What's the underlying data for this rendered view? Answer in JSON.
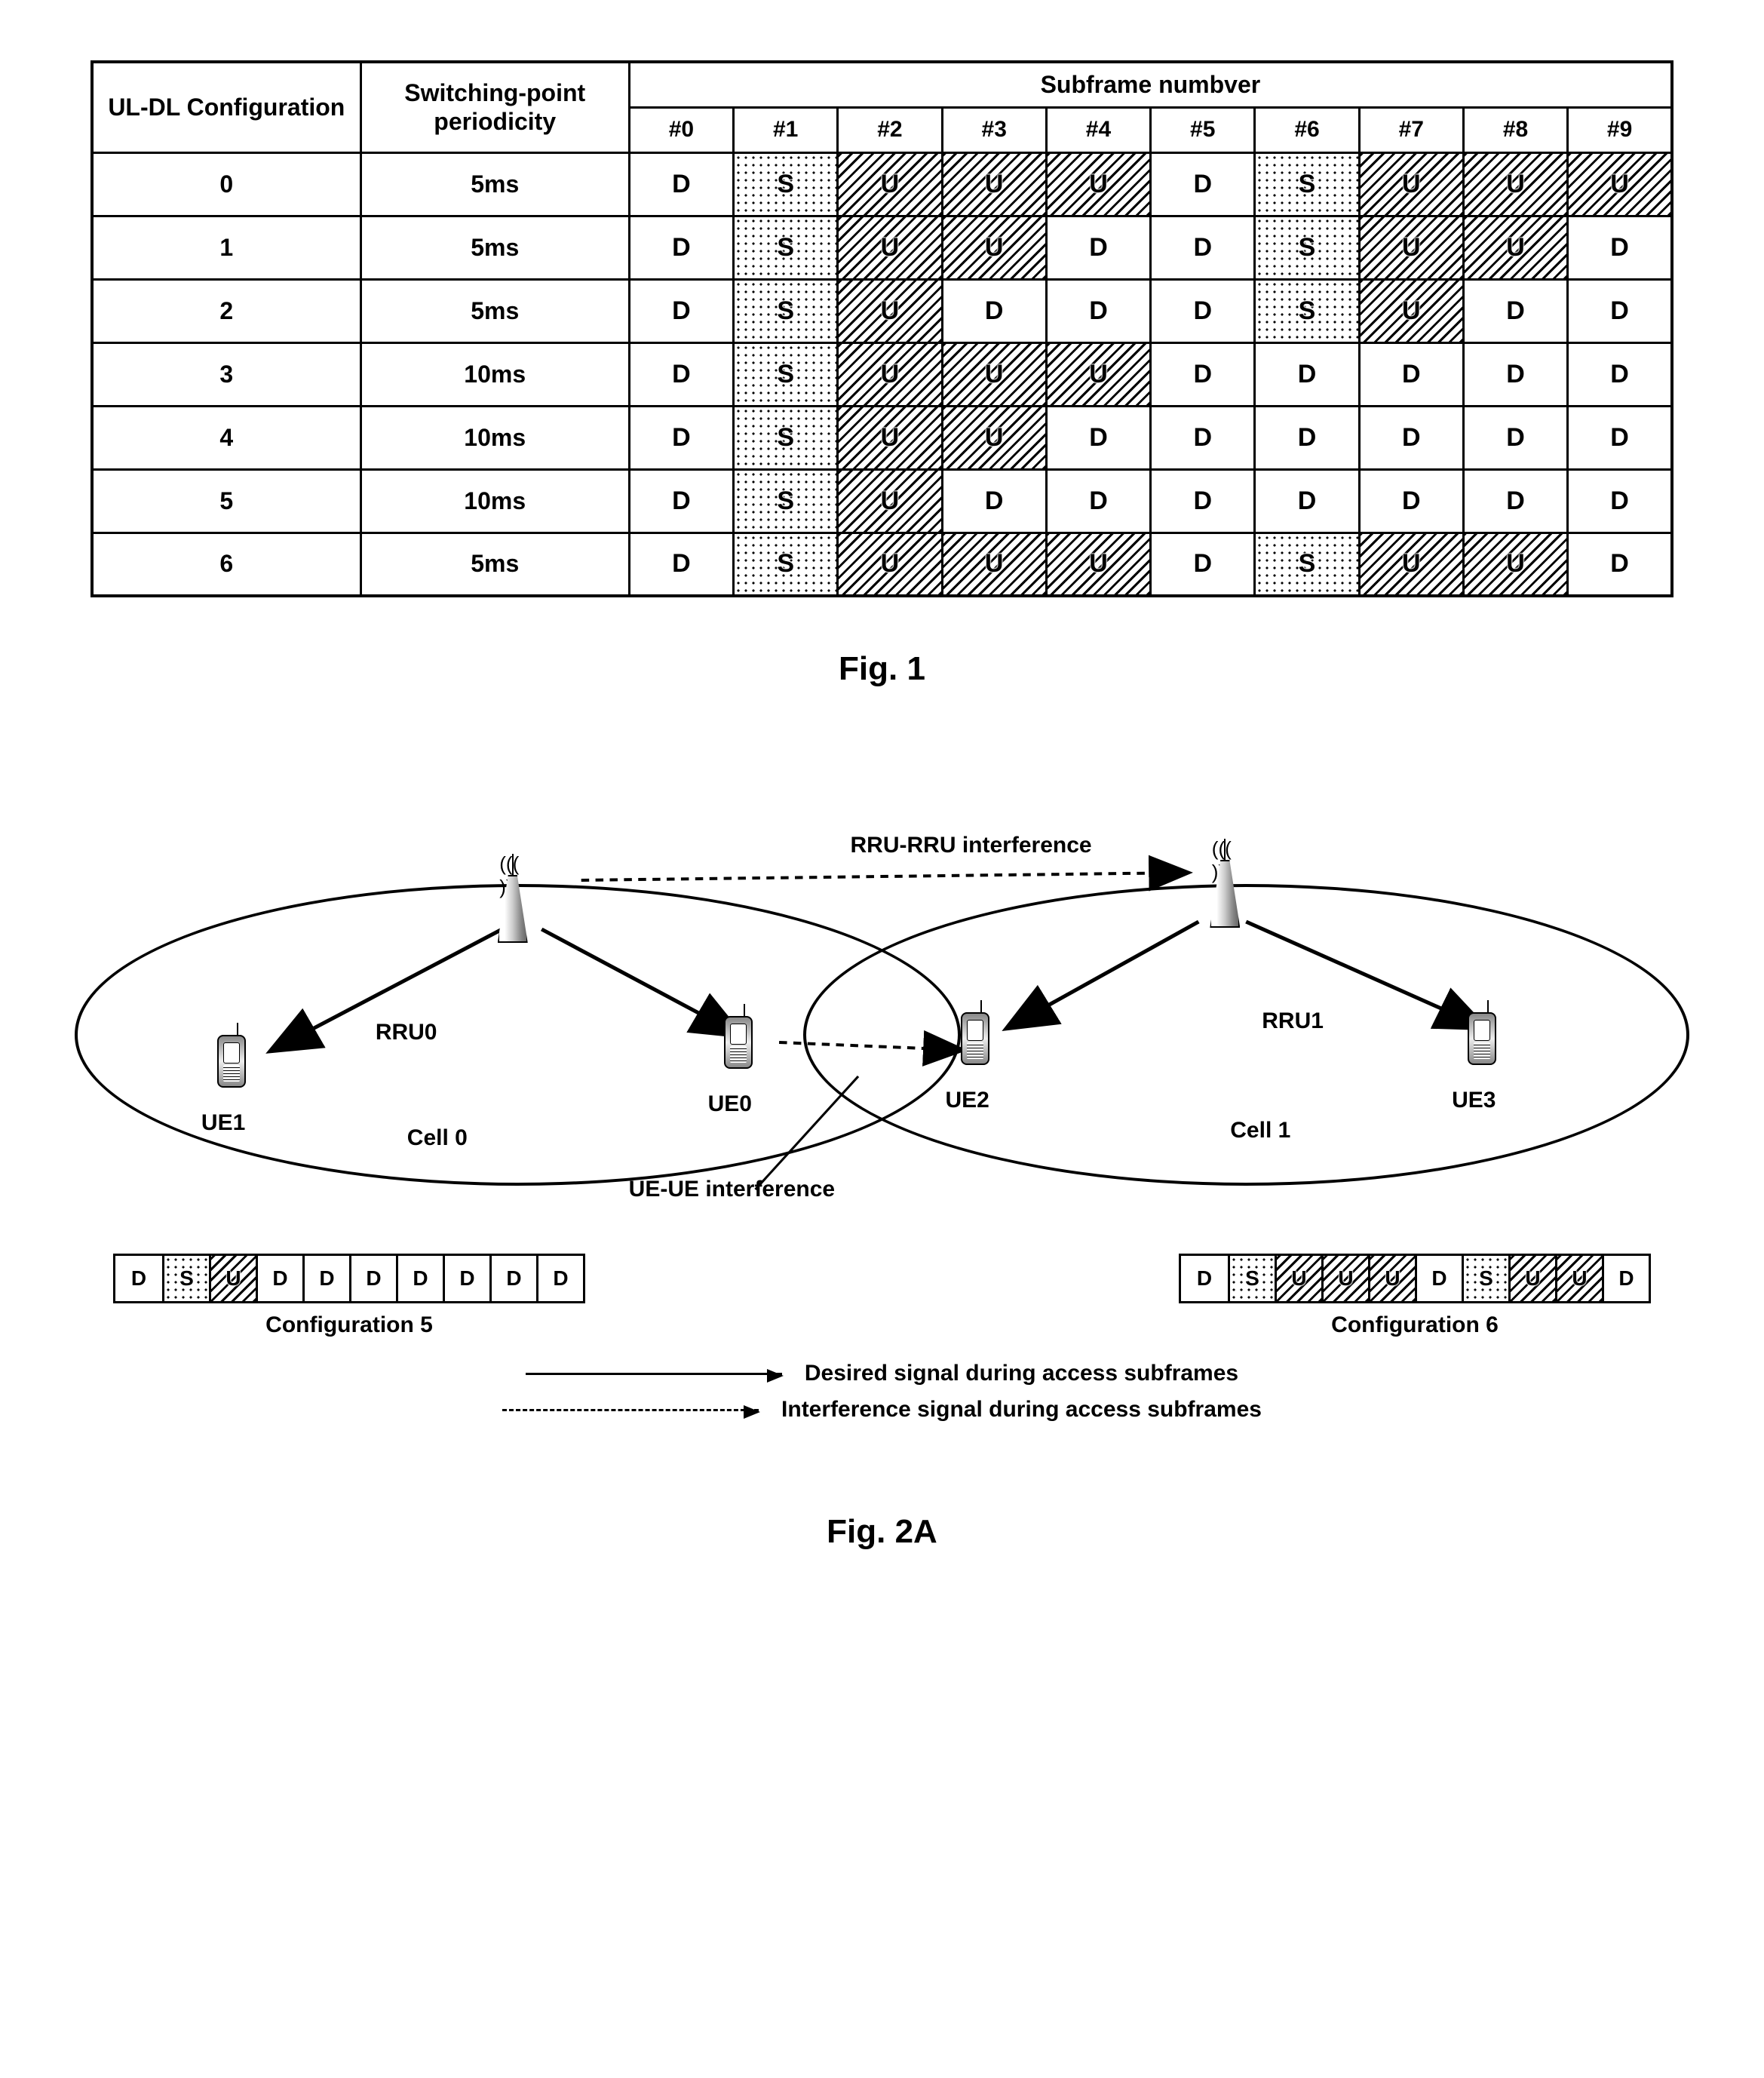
{
  "fig1": {
    "header_col1": "UL-DL Configuration",
    "header_col2": "Switching-point periodicity",
    "header_group": "Subframe numbver",
    "subframe_headers": [
      "#0",
      "#1",
      "#2",
      "#3",
      "#4",
      "#5",
      "#6",
      "#7",
      "#8",
      "#9"
    ],
    "rows": [
      {
        "config": "0",
        "period": "5ms",
        "cells": [
          "D",
          "S",
          "U",
          "U",
          "U",
          "D",
          "S",
          "U",
          "U",
          "U"
        ]
      },
      {
        "config": "1",
        "period": "5ms",
        "cells": [
          "D",
          "S",
          "U",
          "U",
          "D",
          "D",
          "S",
          "U",
          "U",
          "D"
        ]
      },
      {
        "config": "2",
        "period": "5ms",
        "cells": [
          "D",
          "S",
          "U",
          "D",
          "D",
          "D",
          "S",
          "U",
          "D",
          "D"
        ]
      },
      {
        "config": "3",
        "period": "10ms",
        "cells": [
          "D",
          "S",
          "U",
          "U",
          "U",
          "D",
          "D",
          "D",
          "D",
          "D"
        ]
      },
      {
        "config": "4",
        "period": "10ms",
        "cells": [
          "D",
          "S",
          "U",
          "U",
          "D",
          "D",
          "D",
          "D",
          "D",
          "D"
        ]
      },
      {
        "config": "5",
        "period": "10ms",
        "cells": [
          "D",
          "S",
          "U",
          "D",
          "D",
          "D",
          "D",
          "D",
          "D",
          "D"
        ]
      },
      {
        "config": "6",
        "period": "5ms",
        "cells": [
          "D",
          "S",
          "U",
          "U",
          "U",
          "D",
          "S",
          "U",
          "U",
          "D"
        ]
      }
    ],
    "caption": "Fig. 1"
  },
  "fig2a": {
    "rru_iface_label": "RRU-RRU interference",
    "ue_iface_label": "UE-UE interference",
    "rru0": "RRU0",
    "rru1": "RRU1",
    "ue0": "UE0",
    "ue1": "UE1",
    "ue2": "UE2",
    "ue3": "UE3",
    "cell0": "Cell 0",
    "cell1": "Cell 1",
    "config5_caption": "Configuration 5",
    "config6_caption": "Configuration 6",
    "config5_cells": [
      "D",
      "S",
      "U",
      "D",
      "D",
      "D",
      "D",
      "D",
      "D",
      "D"
    ],
    "config6_cells": [
      "D",
      "S",
      "U",
      "U",
      "U",
      "D",
      "S",
      "U",
      "U",
      "D"
    ],
    "legend_desired": "Desired signal during access subframes",
    "legend_interference": "Interference signal during access subframes",
    "caption": "Fig. 2A"
  },
  "chart_data": [
    {
      "type": "table",
      "title": "UL-DL Configurations",
      "columns": [
        "UL-DL Configuration",
        "Switching-point periodicity",
        "#0",
        "#1",
        "#2",
        "#3",
        "#4",
        "#5",
        "#6",
        "#7",
        "#8",
        "#9"
      ],
      "rows": [
        [
          "0",
          "5ms",
          "D",
          "S",
          "U",
          "U",
          "U",
          "D",
          "S",
          "U",
          "U",
          "U"
        ],
        [
          "1",
          "5ms",
          "D",
          "S",
          "U",
          "U",
          "D",
          "D",
          "S",
          "U",
          "U",
          "D"
        ],
        [
          "2",
          "5ms",
          "D",
          "S",
          "U",
          "D",
          "D",
          "D",
          "S",
          "U",
          "D",
          "D"
        ],
        [
          "3",
          "10ms",
          "D",
          "S",
          "U",
          "U",
          "U",
          "D",
          "D",
          "D",
          "D",
          "D"
        ],
        [
          "4",
          "10ms",
          "D",
          "S",
          "U",
          "U",
          "D",
          "D",
          "D",
          "D",
          "D",
          "D"
        ],
        [
          "5",
          "10ms",
          "D",
          "S",
          "U",
          "D",
          "D",
          "D",
          "D",
          "D",
          "D",
          "D"
        ],
        [
          "6",
          "5ms",
          "D",
          "S",
          "U",
          "U",
          "U",
          "D",
          "S",
          "U",
          "U",
          "D"
        ]
      ]
    }
  ]
}
